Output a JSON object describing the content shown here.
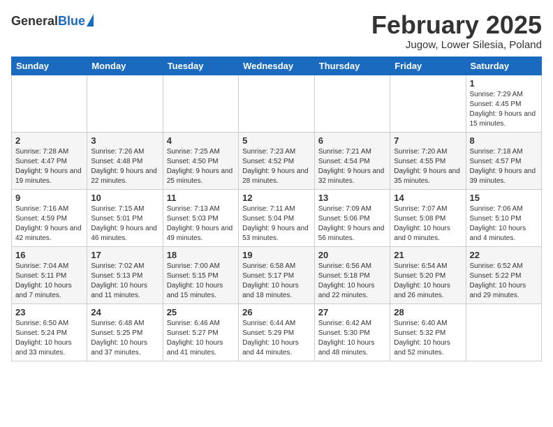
{
  "header": {
    "logo_general": "General",
    "logo_blue": "Blue",
    "month_title": "February 2025",
    "location": "Jugow, Lower Silesia, Poland"
  },
  "calendar": {
    "days_of_week": [
      "Sunday",
      "Monday",
      "Tuesday",
      "Wednesday",
      "Thursday",
      "Friday",
      "Saturday"
    ],
    "weeks": [
      [
        {
          "day": "",
          "info": ""
        },
        {
          "day": "",
          "info": ""
        },
        {
          "day": "",
          "info": ""
        },
        {
          "day": "",
          "info": ""
        },
        {
          "day": "",
          "info": ""
        },
        {
          "day": "",
          "info": ""
        },
        {
          "day": "1",
          "info": "Sunrise: 7:29 AM\nSunset: 4:45 PM\nDaylight: 9 hours and 15 minutes."
        }
      ],
      [
        {
          "day": "2",
          "info": "Sunrise: 7:28 AM\nSunset: 4:47 PM\nDaylight: 9 hours and 19 minutes."
        },
        {
          "day": "3",
          "info": "Sunrise: 7:26 AM\nSunset: 4:48 PM\nDaylight: 9 hours and 22 minutes."
        },
        {
          "day": "4",
          "info": "Sunrise: 7:25 AM\nSunset: 4:50 PM\nDaylight: 9 hours and 25 minutes."
        },
        {
          "day": "5",
          "info": "Sunrise: 7:23 AM\nSunset: 4:52 PM\nDaylight: 9 hours and 28 minutes."
        },
        {
          "day": "6",
          "info": "Sunrise: 7:21 AM\nSunset: 4:54 PM\nDaylight: 9 hours and 32 minutes."
        },
        {
          "day": "7",
          "info": "Sunrise: 7:20 AM\nSunset: 4:55 PM\nDaylight: 9 hours and 35 minutes."
        },
        {
          "day": "8",
          "info": "Sunrise: 7:18 AM\nSunset: 4:57 PM\nDaylight: 9 hours and 39 minutes."
        }
      ],
      [
        {
          "day": "9",
          "info": "Sunrise: 7:16 AM\nSunset: 4:59 PM\nDaylight: 9 hours and 42 minutes."
        },
        {
          "day": "10",
          "info": "Sunrise: 7:15 AM\nSunset: 5:01 PM\nDaylight: 9 hours and 46 minutes."
        },
        {
          "day": "11",
          "info": "Sunrise: 7:13 AM\nSunset: 5:03 PM\nDaylight: 9 hours and 49 minutes."
        },
        {
          "day": "12",
          "info": "Sunrise: 7:11 AM\nSunset: 5:04 PM\nDaylight: 9 hours and 53 minutes."
        },
        {
          "day": "13",
          "info": "Sunrise: 7:09 AM\nSunset: 5:06 PM\nDaylight: 9 hours and 56 minutes."
        },
        {
          "day": "14",
          "info": "Sunrise: 7:07 AM\nSunset: 5:08 PM\nDaylight: 10 hours and 0 minutes."
        },
        {
          "day": "15",
          "info": "Sunrise: 7:06 AM\nSunset: 5:10 PM\nDaylight: 10 hours and 4 minutes."
        }
      ],
      [
        {
          "day": "16",
          "info": "Sunrise: 7:04 AM\nSunset: 5:11 PM\nDaylight: 10 hours and 7 minutes."
        },
        {
          "day": "17",
          "info": "Sunrise: 7:02 AM\nSunset: 5:13 PM\nDaylight: 10 hours and 11 minutes."
        },
        {
          "day": "18",
          "info": "Sunrise: 7:00 AM\nSunset: 5:15 PM\nDaylight: 10 hours and 15 minutes."
        },
        {
          "day": "19",
          "info": "Sunrise: 6:58 AM\nSunset: 5:17 PM\nDaylight: 10 hours and 18 minutes."
        },
        {
          "day": "20",
          "info": "Sunrise: 6:56 AM\nSunset: 5:18 PM\nDaylight: 10 hours and 22 minutes."
        },
        {
          "day": "21",
          "info": "Sunrise: 6:54 AM\nSunset: 5:20 PM\nDaylight: 10 hours and 26 minutes."
        },
        {
          "day": "22",
          "info": "Sunrise: 6:52 AM\nSunset: 5:22 PM\nDaylight: 10 hours and 29 minutes."
        }
      ],
      [
        {
          "day": "23",
          "info": "Sunrise: 6:50 AM\nSunset: 5:24 PM\nDaylight: 10 hours and 33 minutes."
        },
        {
          "day": "24",
          "info": "Sunrise: 6:48 AM\nSunset: 5:25 PM\nDaylight: 10 hours and 37 minutes."
        },
        {
          "day": "25",
          "info": "Sunrise: 6:46 AM\nSunset: 5:27 PM\nDaylight: 10 hours and 41 minutes."
        },
        {
          "day": "26",
          "info": "Sunrise: 6:44 AM\nSunset: 5:29 PM\nDaylight: 10 hours and 44 minutes."
        },
        {
          "day": "27",
          "info": "Sunrise: 6:42 AM\nSunset: 5:30 PM\nDaylight: 10 hours and 48 minutes."
        },
        {
          "day": "28",
          "info": "Sunrise: 6:40 AM\nSunset: 5:32 PM\nDaylight: 10 hours and 52 minutes."
        },
        {
          "day": "",
          "info": ""
        }
      ]
    ]
  }
}
